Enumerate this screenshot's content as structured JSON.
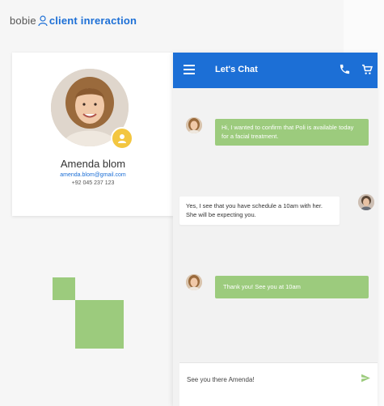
{
  "brand": {
    "prefix": "bobie",
    "suffix": "client inreraction",
    "icon": "person-outline-icon",
    "accent_color": "#1c6fd6"
  },
  "profile": {
    "name": "Amenda blom",
    "email": "amenda.blom@gmail.com",
    "phone": "+92 045 237 123",
    "avatar_icon": "avatar-photo",
    "badge_icon": "user-badge-icon",
    "badge_color": "#f3c640"
  },
  "chat": {
    "title": "Let's Chat",
    "header_color": "#1c6fd6",
    "icons": [
      "menu-icon",
      "phone-icon",
      "cart-icon"
    ],
    "messages": [
      {
        "side": "client",
        "text": "Hi, I wanted to confirm that Poli is available today for a facial treatment."
      },
      {
        "side": "agent",
        "text": "Yes, I see that you have schedule a 10am with her. She will be expecting you."
      },
      {
        "side": "client",
        "text": "Thank you! See you at 10am"
      }
    ],
    "bubble_color": "#9ccb7d",
    "input_value": "See you there Amenda!",
    "send_icon": "send-icon"
  },
  "decor_color": "#9ccb7d"
}
